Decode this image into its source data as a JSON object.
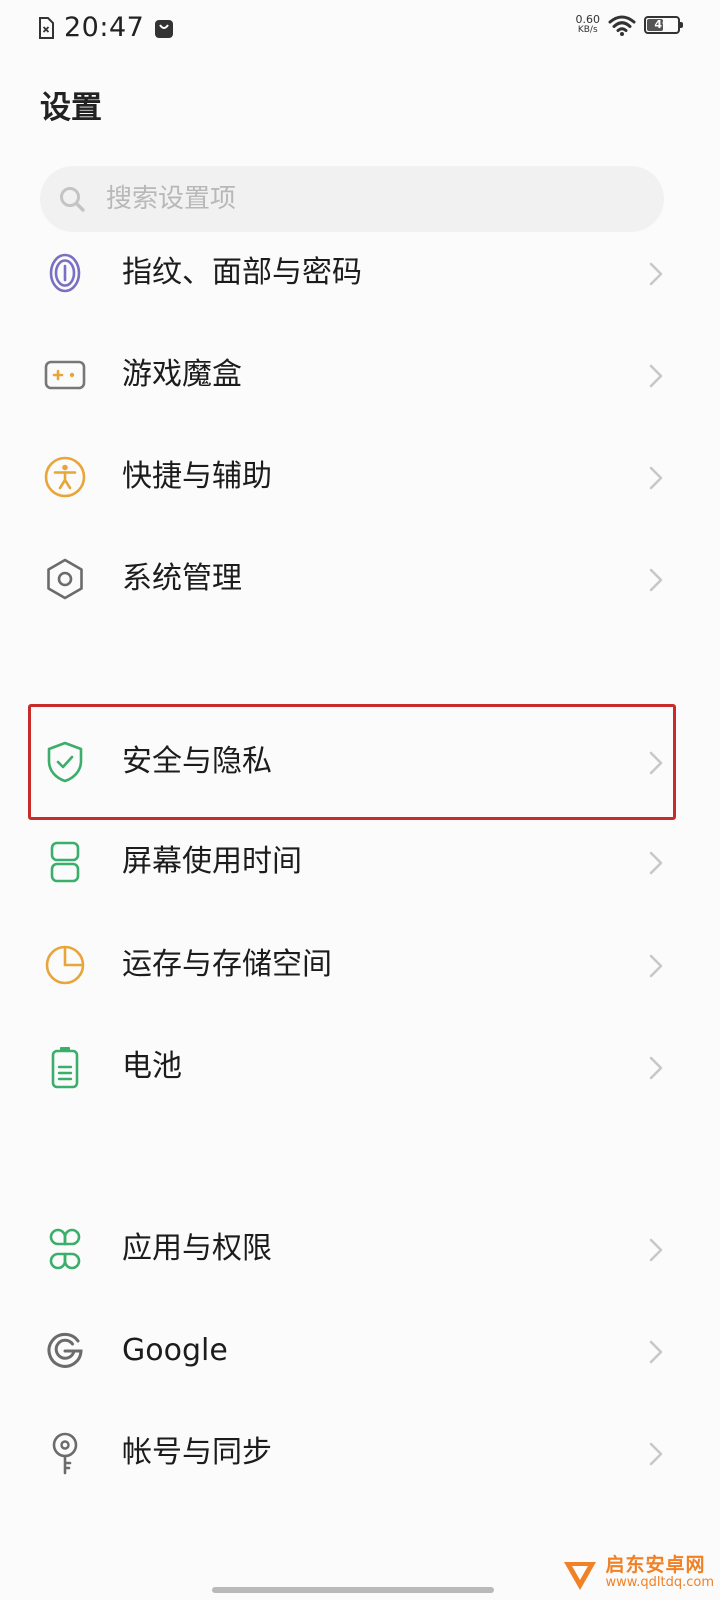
{
  "status_bar": {
    "time": "20:47",
    "net_speed_value": "0.60",
    "net_speed_unit": "KB/s",
    "battery_level": "49"
  },
  "page": {
    "title": "设置"
  },
  "search": {
    "placeholder": "搜索设置项"
  },
  "menu": {
    "items": [
      {
        "label": "指纹、面部与密码",
        "icon": "fingerprint-icon"
      },
      {
        "label": "游戏魔盒",
        "icon": "gamepad-icon"
      },
      {
        "label": "快捷与辅助",
        "icon": "accessibility-icon"
      },
      {
        "label": "系统管理",
        "icon": "settings-hex-icon"
      },
      {
        "label": "安全与隐私",
        "icon": "shield-check-icon"
      },
      {
        "label": "屏幕使用时间",
        "icon": "hourglass-icon"
      },
      {
        "label": "运存与存储空间",
        "icon": "storage-pie-icon"
      },
      {
        "label": "电池",
        "icon": "battery-icon"
      },
      {
        "label": "应用与权限",
        "icon": "apps-grid-icon"
      },
      {
        "label": "Google",
        "icon": "google-icon"
      },
      {
        "label": "帐号与同步",
        "icon": "account-key-icon"
      }
    ]
  },
  "watermark": {
    "name": "启东安卓网",
    "url": "www.qdltdq.com"
  },
  "colors": {
    "highlight_border": "#c92a2a",
    "icon_purple": "#7a6fc2",
    "icon_orange": "#e8a53a",
    "icon_gray": "#6b6b6b",
    "icon_green": "#3bae6b"
  }
}
